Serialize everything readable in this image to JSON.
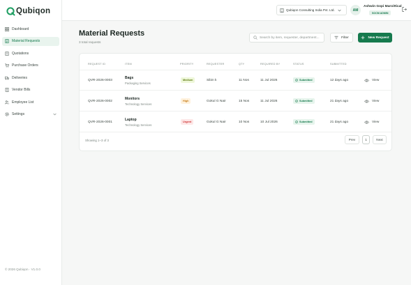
{
  "brand": {
    "name": "Qubiqon",
    "accent": "#167a4e"
  },
  "sidebar": {
    "items": [
      {
        "label": "Dashboard",
        "icon": "dashboard-icon"
      },
      {
        "label": "Material Requests",
        "icon": "document-icon"
      },
      {
        "label": "Quotations",
        "icon": "quotation-icon"
      },
      {
        "label": "Purchase Orders",
        "icon": "cart-icon"
      },
      {
        "label": "Deliveries",
        "icon": "truck-icon"
      },
      {
        "label": "Vendor Bills",
        "icon": "receipt-icon"
      },
      {
        "label": "Employee List",
        "icon": "users-icon"
      },
      {
        "label": "Settings",
        "icon": "gear-icon"
      }
    ],
    "active_index": 1,
    "footer": "© 2026 Qubiqon · V1.0.0"
  },
  "topbar": {
    "company": "Qubiqon Consulting India Pvt. Ltd.",
    "user_initials": "AM",
    "user_name": "Ashwin Gopi Maroittical",
    "user_role": "SOCM ADMIN"
  },
  "page": {
    "title": "Material Requests",
    "subtitle": "3 total requests",
    "search_placeholder": "Search by item, requester, department...",
    "filter_label": "Filter",
    "new_label": "New Request"
  },
  "table": {
    "columns": [
      "REQUEST ID",
      "ITEM",
      "PRIORITY",
      "REQUESTER",
      "QTY",
      "REQUIRED BY",
      "STATUS",
      "SUBMITTED"
    ],
    "rows": [
      {
        "id": "QVR-2026-0003",
        "item": "Bags",
        "category": "Packaging Services",
        "priority": "Medium",
        "requester": "Sibin k",
        "qty": "11 Nos",
        "required_by": "11 Jul 2026",
        "status": "Submitted",
        "submitted": "12 days ago",
        "action": "View"
      },
      {
        "id": "QVR-2026-0002",
        "item": "Monitors",
        "category": "Technology Services",
        "priority": "High",
        "requester": "Gokul G Nair",
        "qty": "15 Nos",
        "required_by": "11 Jul 2026",
        "status": "Submitted",
        "submitted": "21 days ago",
        "action": "View"
      },
      {
        "id": "QVR-2026-0001",
        "item": "Laptop",
        "category": "Technology Services",
        "priority": "Urgent",
        "requester": "Gokul G Nair",
        "qty": "10 Nos",
        "required_by": "10 Jul 2026",
        "status": "Submitted",
        "submitted": "21 days ago",
        "action": "View"
      }
    ],
    "priority_colors": {
      "Medium": {
        "bg": "#eef7d9",
        "fg": "#5d7a12"
      },
      "High": {
        "bg": "#fff1dc",
        "fg": "#c67a14"
      },
      "Urgent": {
        "bg": "#fde7e7",
        "fg": "#cf3434"
      }
    }
  },
  "pagination": {
    "showing": "Showing 1–3 of 3",
    "prev": "Prev",
    "page": "1",
    "next": "Next"
  }
}
